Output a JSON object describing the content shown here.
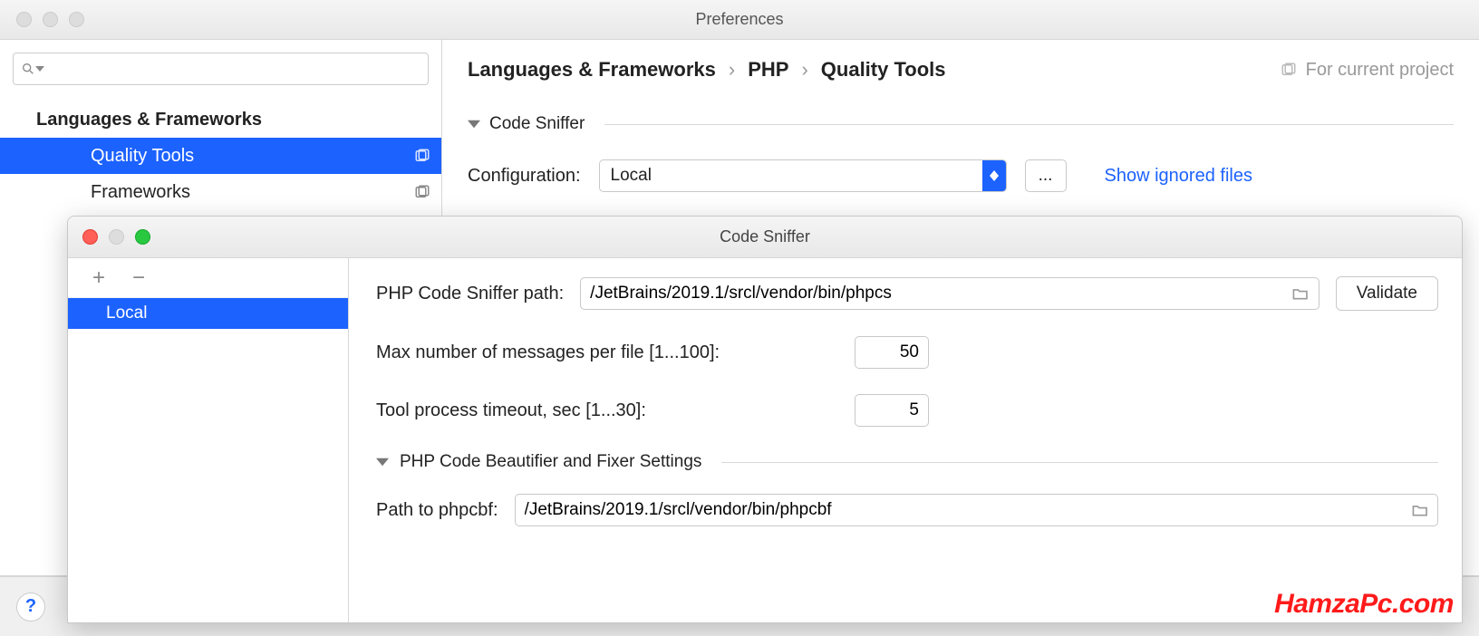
{
  "prefs": {
    "title": "Preferences",
    "search_placeholder": "",
    "tree": {
      "group_label": "Languages & Frameworks",
      "item_quality_tools": "Quality Tools",
      "item_frameworks": "Frameworks"
    },
    "breadcrumb": {
      "a": "Languages & Frameworks",
      "b": "PHP",
      "c": "Quality Tools"
    },
    "for_current_project": "For current project",
    "section_code_sniffer": "Code Sniffer",
    "config_label": "Configuration:",
    "config_value": "Local",
    "ellipsis": "...",
    "show_ignored": "Show ignored files"
  },
  "sub": {
    "title": "Code Sniffer",
    "list_item": "Local",
    "path_label": "PHP Code Sniffer path:",
    "path_value": "/JetBrains/2019.1/srcl/vendor/bin/phpcs",
    "validate_label": "Validate",
    "max_label": "Max number of messages per file [1...100]:",
    "max_value": "50",
    "timeout_label": "Tool process timeout, sec [1...30]:",
    "timeout_value": "5",
    "beautifier_section": "PHP Code Beautifier and Fixer Settings",
    "phpcbf_label": "Path to phpcbf:",
    "phpcbf_value": "/JetBrains/2019.1/srcl/vendor/bin/phpcbf"
  },
  "watermark": "HamzaPc.com",
  "help_glyph": "?"
}
